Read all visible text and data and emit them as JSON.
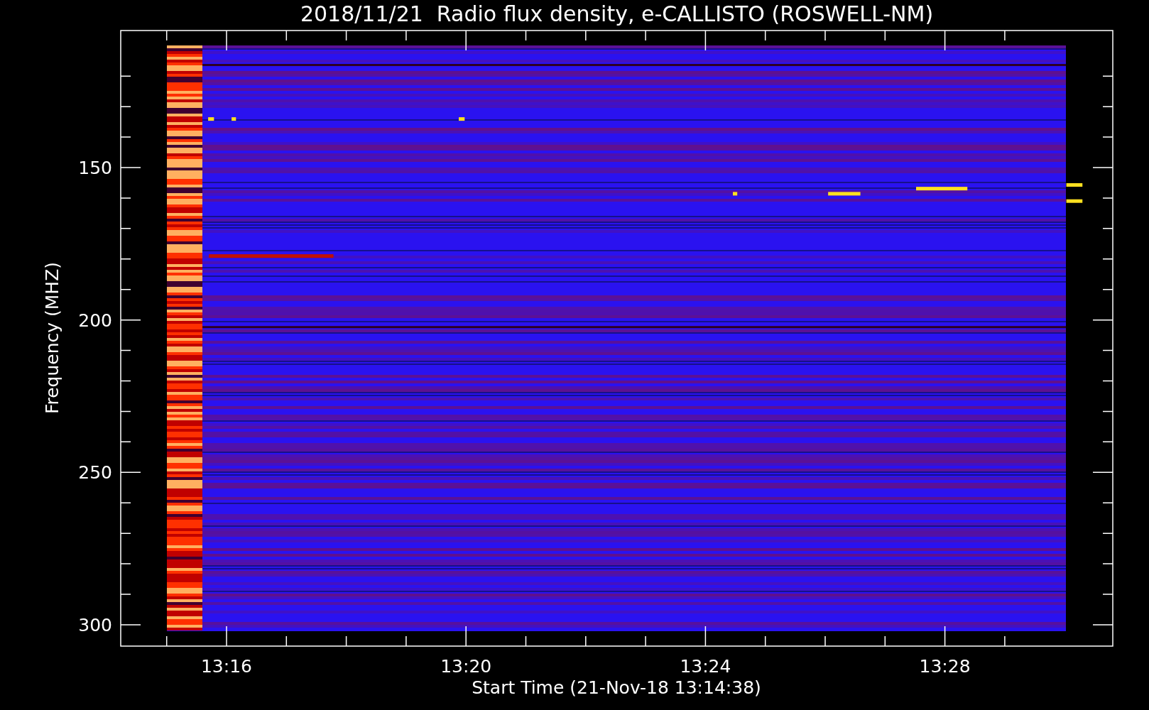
{
  "title": "2018/11/21  Radio flux density, e-CALLISTO (ROSWELL-NM)",
  "y_axis": {
    "label": "Frequency (MHZ)",
    "ticks": [
      "150",
      "200",
      "250",
      "300"
    ]
  },
  "x_axis": {
    "label": "Start Time (21-Nov-18 13:14:38)",
    "ticks": [
      "13:16",
      "13:20",
      "13:24",
      "13:28"
    ]
  }
}
